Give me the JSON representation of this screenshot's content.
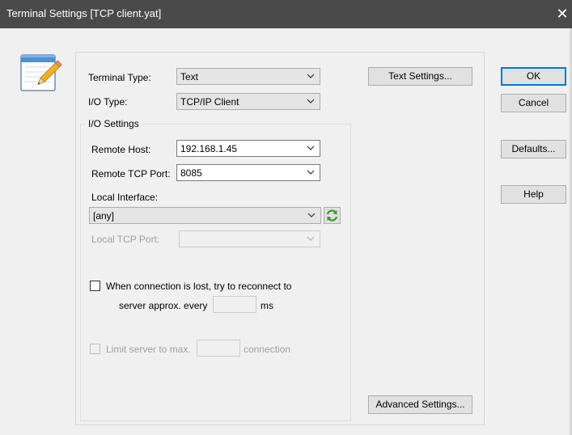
{
  "window": {
    "title": "Terminal Settings [TCP client.yat]",
    "close_glyph": "✕"
  },
  "icons": {
    "app": "terminal-settings-notepad-pencil-icon",
    "chevron": "chevron-down-icon",
    "refresh": "refresh-green-arrows-icon",
    "close": "close-icon"
  },
  "colors": {
    "titlebar": "#4a4a4a",
    "dialog_bg": "#f0f0f0",
    "default_button_border": "#0078d7",
    "refresh_green": "#3a9a2a"
  },
  "main": {
    "terminal_type_label": "Terminal Type:",
    "terminal_type_value": "Text",
    "io_type_label": "I/O Type:",
    "io_type_value": "TCP/IP Client",
    "text_settings_button": "Text Settings...",
    "io_settings": {
      "caption": "I/O Settings",
      "remote_host_label": "Remote Host:",
      "remote_host_value": "192.168.1.45",
      "remote_port_label": "Remote TCP Port:",
      "remote_port_value": "8085",
      "local_interface_label": "Local Interface:",
      "local_interface_value": "[any]",
      "local_port_label": "Local TCP Port:",
      "local_port_value": "",
      "reconnect": {
        "checked": false,
        "label_line1": "When connection is lost, try to reconnect to",
        "label_line2": "server approx. every",
        "interval_value": "",
        "unit": "ms"
      },
      "limit": {
        "checked": false,
        "enabled": false,
        "label": "Limit server to max.",
        "value": "",
        "unit": "connection"
      }
    },
    "advanced_settings_button": "Advanced Settings..."
  },
  "side_buttons": {
    "ok": "OK",
    "cancel": "Cancel",
    "defaults": "Defaults...",
    "help": "Help"
  }
}
